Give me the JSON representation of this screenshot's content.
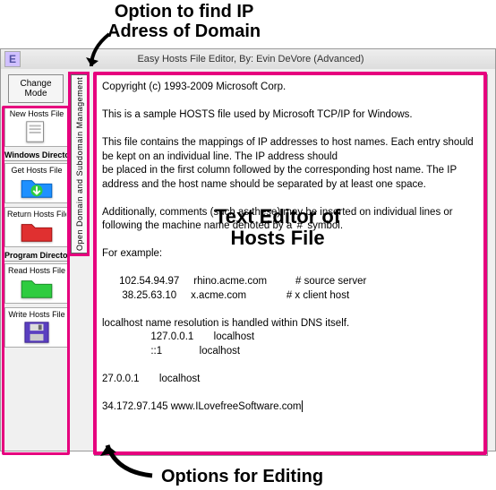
{
  "annotations": {
    "top": "Option to find IP\nAdress of Domain",
    "mid": "Text Editor of\nHosts File",
    "bot": "Options for Editing"
  },
  "window": {
    "icon_letter": "E",
    "title": "Easy Hosts File Editor, By: Evin DeVore (Advanced)"
  },
  "change_mode": "Change\nMode",
  "side_tab": "Open Domain and Subdomain Management",
  "sections": {
    "s0": {
      "label": "New Hosts File"
    },
    "s1": {
      "title": "Windows Directory",
      "b0": "Get Hosts File",
      "b1": "Return Hosts File"
    },
    "s2": {
      "title": "Program Directory",
      "b0": "Read Hosts File",
      "b1": "Write Hosts File"
    }
  },
  "editor": {
    "l0": "Copyright (c) 1993-2009 Microsoft Corp.",
    "l1": "",
    "l2": "This is a sample HOSTS file used by Microsoft TCP/IP for Windows.",
    "l3": "",
    "l4": "This file contains the mappings of IP addresses to host names. Each entry should be kept on an individual line. The IP address should",
    "l5": "be placed in the first column followed by the corresponding host name. The IP address and the host name should be separated by at least one space.",
    "l6": "",
    "l7": "Additionally, comments (such as these) may be inserted on individual lines or following the machine name denoted by a '#' symbol.",
    "l8": "",
    "l9": "For example:",
    "l10": "",
    "l11": "      102.54.94.97     rhino.acme.com          # source server",
    "l12": "       38.25.63.10     x.acme.com              # x client host",
    "l13": "",
    "l14": "localhost name resolution is handled within DNS itself.",
    "l15": "                 127.0.0.1       localhost",
    "l16": "                 ::1             localhost",
    "l17": "",
    "l18": "27.0.0.1       localhost",
    "l19": "",
    "l20": "34.172.97.145 www.ILovefreeSoftware.com"
  }
}
